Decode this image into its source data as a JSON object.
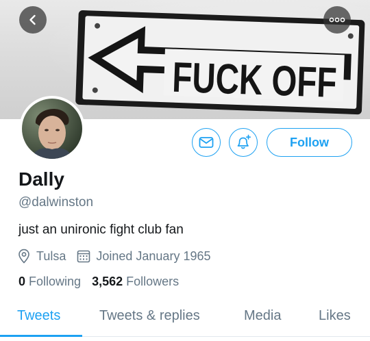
{
  "banner": {
    "sign_text": "FUCK OFF"
  },
  "header": {
    "back_icon": "chevron-left-icon",
    "more_icon": "more-horizontal-icon"
  },
  "actions": {
    "message_icon": "envelope-icon",
    "notify_icon": "bell-plus-icon",
    "follow_label": "Follow",
    "accent_color": "#1da1f2"
  },
  "profile": {
    "display_name": "Dally",
    "handle": "@dalwinston",
    "bio": "just an unironic fight club fan",
    "location": "Tulsa",
    "joined": "Joined January 1965",
    "following_count": "0",
    "following_label": "Following",
    "followers_count": "3,562",
    "followers_label": "Followers"
  },
  "tabs": [
    {
      "label": "Tweets",
      "active": true
    },
    {
      "label": "Tweets & replies",
      "active": false
    },
    {
      "label": "Media",
      "active": false
    },
    {
      "label": "Likes",
      "active": false
    }
  ]
}
